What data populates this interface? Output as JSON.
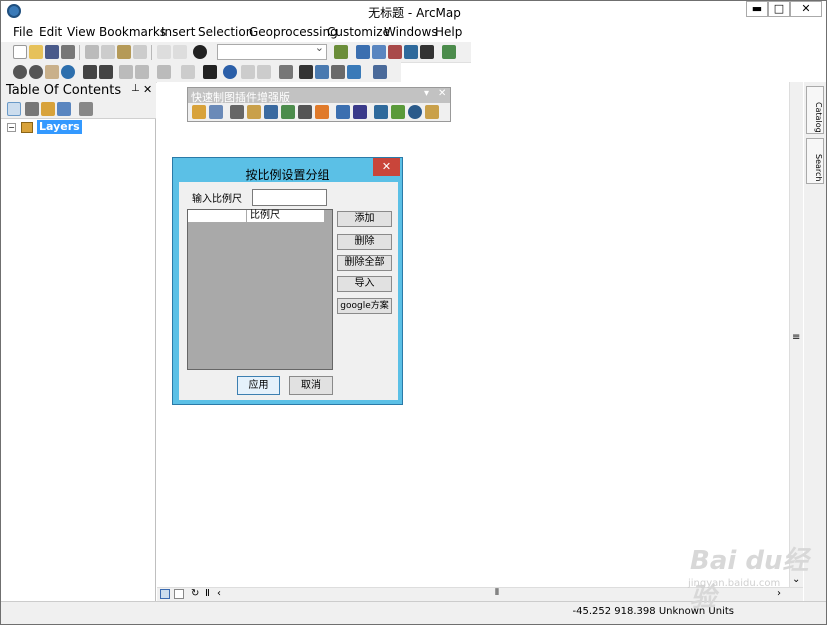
{
  "window": {
    "title": "无标题 - ArcMap",
    "min": "▬",
    "max": "□",
    "close": "✕"
  },
  "menu": [
    "File",
    "Edit",
    "View",
    "Bookmarks",
    "Insert",
    "Selection",
    "Geoprocessing",
    "Customize",
    "Windows",
    "Help"
  ],
  "toc": {
    "title": "Table Of Contents",
    "pin": "⊥",
    "close": "✕",
    "layers_label": "Layers"
  },
  "floating_toolbar": {
    "title": "快速制图插件增强版",
    "dropdown": "▾",
    "close": "✕"
  },
  "dialog": {
    "title": "按比例设置分组",
    "close": "✕",
    "scale_label": "输入比例尺",
    "scale_value": "",
    "list_header": "比例尺",
    "buttons": {
      "add": "添加",
      "delete": "删除",
      "delete_all": "删除全部",
      "import": "导入",
      "google": "google方案",
      "apply": "应用",
      "cancel": "取消"
    }
  },
  "side_tabs": [
    "Catalog",
    "Search"
  ],
  "status": {
    "coords": "-45.252  918.398 Unknown Units"
  },
  "watermark": {
    "text": "Bai du经验",
    "url": "jingyan.baidu.com"
  }
}
